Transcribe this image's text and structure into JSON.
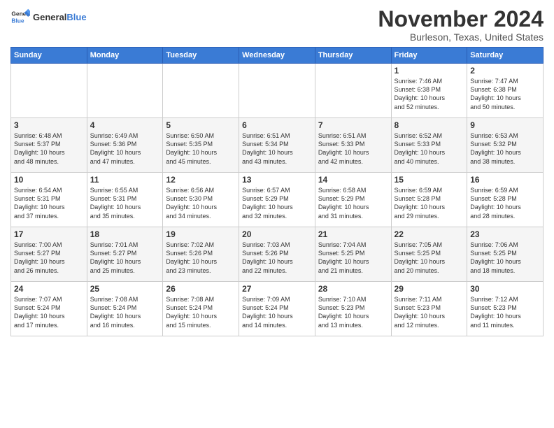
{
  "logo": {
    "general": "General",
    "blue": "Blue"
  },
  "title": "November 2024",
  "location": "Burleson, Texas, United States",
  "days_of_week": [
    "Sunday",
    "Monday",
    "Tuesday",
    "Wednesday",
    "Thursday",
    "Friday",
    "Saturday"
  ],
  "weeks": [
    [
      {
        "day": "",
        "info": ""
      },
      {
        "day": "",
        "info": ""
      },
      {
        "day": "",
        "info": ""
      },
      {
        "day": "",
        "info": ""
      },
      {
        "day": "",
        "info": ""
      },
      {
        "day": "1",
        "info": "Sunrise: 7:46 AM\nSunset: 6:38 PM\nDaylight: 10 hours\nand 52 minutes."
      },
      {
        "day": "2",
        "info": "Sunrise: 7:47 AM\nSunset: 6:38 PM\nDaylight: 10 hours\nand 50 minutes."
      }
    ],
    [
      {
        "day": "3",
        "info": "Sunrise: 6:48 AM\nSunset: 5:37 PM\nDaylight: 10 hours\nand 48 minutes."
      },
      {
        "day": "4",
        "info": "Sunrise: 6:49 AM\nSunset: 5:36 PM\nDaylight: 10 hours\nand 47 minutes."
      },
      {
        "day": "5",
        "info": "Sunrise: 6:50 AM\nSunset: 5:35 PM\nDaylight: 10 hours\nand 45 minutes."
      },
      {
        "day": "6",
        "info": "Sunrise: 6:51 AM\nSunset: 5:34 PM\nDaylight: 10 hours\nand 43 minutes."
      },
      {
        "day": "7",
        "info": "Sunrise: 6:51 AM\nSunset: 5:33 PM\nDaylight: 10 hours\nand 42 minutes."
      },
      {
        "day": "8",
        "info": "Sunrise: 6:52 AM\nSunset: 5:33 PM\nDaylight: 10 hours\nand 40 minutes."
      },
      {
        "day": "9",
        "info": "Sunrise: 6:53 AM\nSunset: 5:32 PM\nDaylight: 10 hours\nand 38 minutes."
      }
    ],
    [
      {
        "day": "10",
        "info": "Sunrise: 6:54 AM\nSunset: 5:31 PM\nDaylight: 10 hours\nand 37 minutes."
      },
      {
        "day": "11",
        "info": "Sunrise: 6:55 AM\nSunset: 5:31 PM\nDaylight: 10 hours\nand 35 minutes."
      },
      {
        "day": "12",
        "info": "Sunrise: 6:56 AM\nSunset: 5:30 PM\nDaylight: 10 hours\nand 34 minutes."
      },
      {
        "day": "13",
        "info": "Sunrise: 6:57 AM\nSunset: 5:29 PM\nDaylight: 10 hours\nand 32 minutes."
      },
      {
        "day": "14",
        "info": "Sunrise: 6:58 AM\nSunset: 5:29 PM\nDaylight: 10 hours\nand 31 minutes."
      },
      {
        "day": "15",
        "info": "Sunrise: 6:59 AM\nSunset: 5:28 PM\nDaylight: 10 hours\nand 29 minutes."
      },
      {
        "day": "16",
        "info": "Sunrise: 6:59 AM\nSunset: 5:28 PM\nDaylight: 10 hours\nand 28 minutes."
      }
    ],
    [
      {
        "day": "17",
        "info": "Sunrise: 7:00 AM\nSunset: 5:27 PM\nDaylight: 10 hours\nand 26 minutes."
      },
      {
        "day": "18",
        "info": "Sunrise: 7:01 AM\nSunset: 5:27 PM\nDaylight: 10 hours\nand 25 minutes."
      },
      {
        "day": "19",
        "info": "Sunrise: 7:02 AM\nSunset: 5:26 PM\nDaylight: 10 hours\nand 23 minutes."
      },
      {
        "day": "20",
        "info": "Sunrise: 7:03 AM\nSunset: 5:26 PM\nDaylight: 10 hours\nand 22 minutes."
      },
      {
        "day": "21",
        "info": "Sunrise: 7:04 AM\nSunset: 5:25 PM\nDaylight: 10 hours\nand 21 minutes."
      },
      {
        "day": "22",
        "info": "Sunrise: 7:05 AM\nSunset: 5:25 PM\nDaylight: 10 hours\nand 20 minutes."
      },
      {
        "day": "23",
        "info": "Sunrise: 7:06 AM\nSunset: 5:25 PM\nDaylight: 10 hours\nand 18 minutes."
      }
    ],
    [
      {
        "day": "24",
        "info": "Sunrise: 7:07 AM\nSunset: 5:24 PM\nDaylight: 10 hours\nand 17 minutes."
      },
      {
        "day": "25",
        "info": "Sunrise: 7:08 AM\nSunset: 5:24 PM\nDaylight: 10 hours\nand 16 minutes."
      },
      {
        "day": "26",
        "info": "Sunrise: 7:08 AM\nSunset: 5:24 PM\nDaylight: 10 hours\nand 15 minutes."
      },
      {
        "day": "27",
        "info": "Sunrise: 7:09 AM\nSunset: 5:24 PM\nDaylight: 10 hours\nand 14 minutes."
      },
      {
        "day": "28",
        "info": "Sunrise: 7:10 AM\nSunset: 5:23 PM\nDaylight: 10 hours\nand 13 minutes."
      },
      {
        "day": "29",
        "info": "Sunrise: 7:11 AM\nSunset: 5:23 PM\nDaylight: 10 hours\nand 12 minutes."
      },
      {
        "day": "30",
        "info": "Sunrise: 7:12 AM\nSunset: 5:23 PM\nDaylight: 10 hours\nand 11 minutes."
      }
    ]
  ]
}
